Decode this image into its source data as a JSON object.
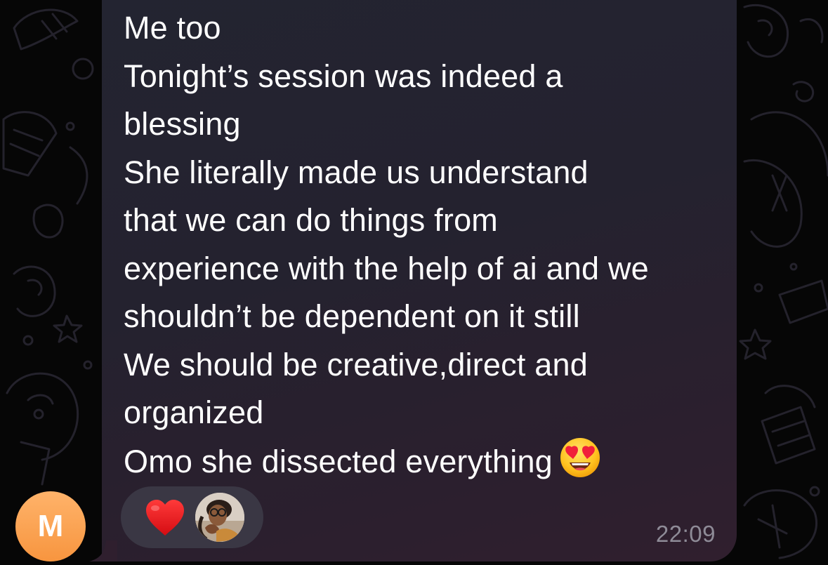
{
  "message": {
    "lines": [
      "Me too",
      "Tonight’s session was indeed a",
      "blessing",
      "She literally made us understand",
      "that we can do things from",
      "experience with the help of ai and we",
      "shouldn’t be dependent on it still",
      "We should be creative,direct and",
      "organized",
      "Omo she dissected everything"
    ],
    "trailing_emoji": "heart-eyes-emoji",
    "timestamp": "22:09"
  },
  "reactions": {
    "emoji": "red-heart-emoji",
    "reactor_avatar": "user-photo"
  },
  "sender": {
    "avatar_initial": "M",
    "avatar_color": "#f89a45"
  },
  "colors": {
    "background": "#060606",
    "bubble": "#25232f",
    "text": "#ffffff",
    "timestamp": "#8e8b97",
    "heart": "#e8141a"
  }
}
